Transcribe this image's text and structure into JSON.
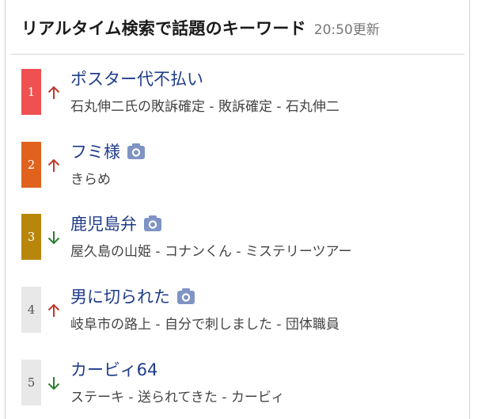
{
  "header": {
    "title": "リアルタイム検索で話題のキーワード",
    "time": "20:50更新"
  },
  "colors": {
    "rank1": "#f05050",
    "rank2": "#e0621c",
    "rank3": "#b8860b",
    "rank_plain": "#e8e8e8",
    "up": "#c0392b",
    "down": "#2e7d32",
    "link": "#1f3c8a",
    "camera": "#7f94c4"
  },
  "items": [
    {
      "rank": "1",
      "trend": "up",
      "keyword": "ポスター代不払い",
      "has_photo": false,
      "related": "石丸伸二氏の敗訴確定 - 敗訴確定 - 石丸伸二"
    },
    {
      "rank": "2",
      "trend": "up",
      "keyword": "フミ様",
      "has_photo": true,
      "related": "きらめ"
    },
    {
      "rank": "3",
      "trend": "down",
      "keyword": "鹿児島弁",
      "has_photo": true,
      "related": "屋久島の山姫 - コナンくん - ミステリーツアー"
    },
    {
      "rank": "4",
      "trend": "up",
      "keyword": "男に切られた",
      "has_photo": true,
      "related": "岐阜市の路上 - 自分で刺しました - 団体職員"
    },
    {
      "rank": "5",
      "trend": "down",
      "keyword": "カービィ64",
      "has_photo": false,
      "related": "ステーキ - 送られてきた - カービィ"
    }
  ]
}
